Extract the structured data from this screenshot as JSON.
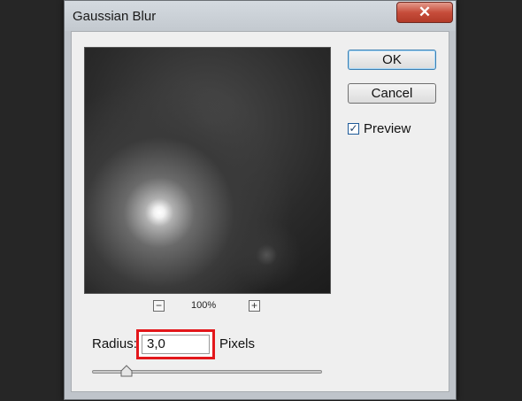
{
  "window": {
    "title": "Gaussian Blur",
    "close_label": "✕"
  },
  "buttons": {
    "ok_label": "OK",
    "cancel_label": "Cancel"
  },
  "preview_option": {
    "label": "Preview",
    "checked": true,
    "check_glyph": "✓"
  },
  "zoom": {
    "level": "100%",
    "minus": "−",
    "plus": "+"
  },
  "radius": {
    "label": "Radius:",
    "value": "3,0",
    "unit": "Pixels",
    "slider_fraction": 0.15
  },
  "colors": {
    "highlight": "#e3171b",
    "ok_border": "#3c7fb1"
  }
}
